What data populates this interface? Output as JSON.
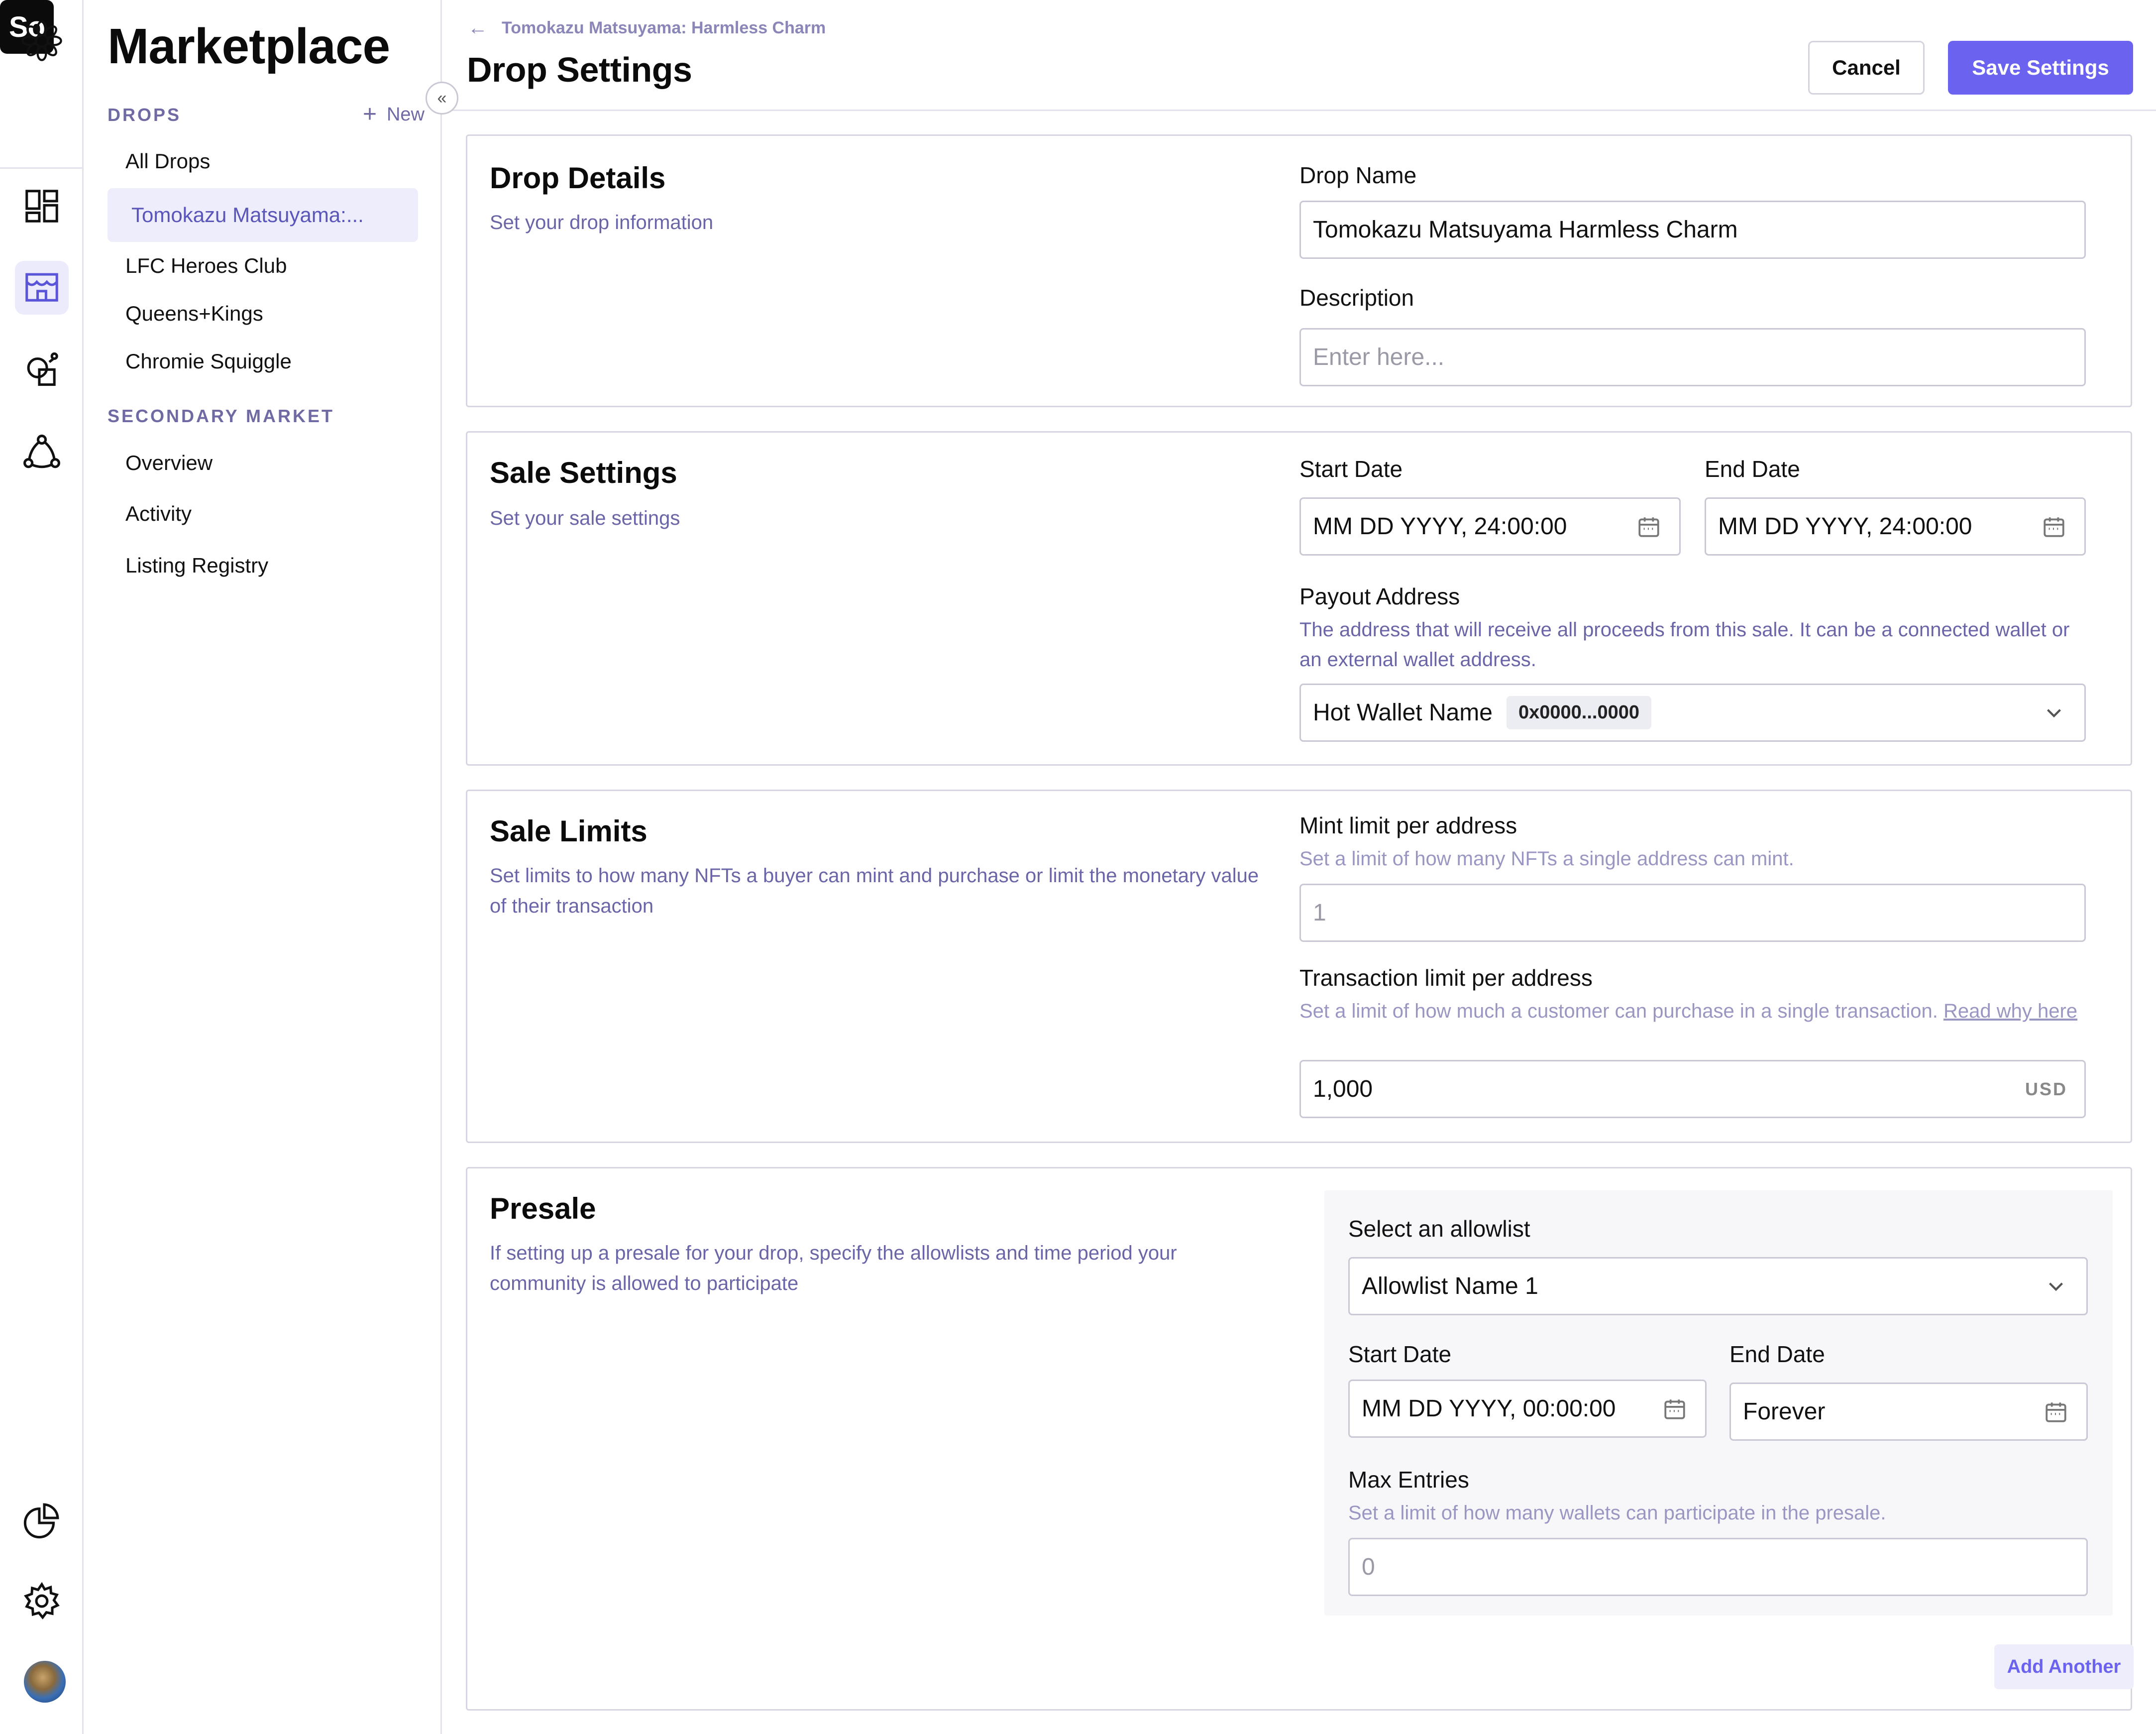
{
  "rail": {
    "org_initials": "So",
    "icons": [
      "logo-flower-icon",
      "dashboard-icon",
      "marketplace-icon",
      "assets-icon",
      "network-icon",
      "analytics-icon",
      "settings-icon"
    ]
  },
  "sidebar": {
    "title": "Marketplace",
    "drops_label": "DROPS",
    "new_label": "New",
    "drops": [
      "All Drops",
      "Tomokazu Matsuyama:...",
      "LFC Heroes Club",
      "Queens+Kings",
      "Chromie Squiggle"
    ],
    "secondary_label": "SECONDARY MARKET",
    "secondary": [
      "Overview",
      "Activity",
      "Listing Registry"
    ]
  },
  "header": {
    "breadcrumb": "Tomokazu Matsuyama: Harmless Charm",
    "title": "Drop Settings",
    "cancel": "Cancel",
    "save": "Save Settings"
  },
  "drop_details": {
    "title": "Drop Details",
    "desc": "Set your drop information",
    "name_label": "Drop Name",
    "name_value": "Tomokazu Matsuyama Harmless Charm",
    "description_label": "Description",
    "description_placeholder": "Enter here..."
  },
  "sale_settings": {
    "title": "Sale Settings",
    "desc": "Set your sale settings",
    "start_label": "Start Date",
    "start_value": "MM DD YYYY, 24:00:00",
    "end_label": "End Date",
    "end_value": "MM DD YYYY, 24:00:00",
    "payout_label": "Payout Address",
    "payout_help": "The address that will receive all proceeds from this sale. It can be a connected wallet or an external wallet address.",
    "wallet_name": "Hot Wallet Name",
    "wallet_address": "0x0000...0000"
  },
  "sale_limits": {
    "title": "Sale Limits",
    "desc": "Set limits to how many NFTs a buyer can mint and purchase or limit the monetary value of their transaction",
    "mint_label": "Mint limit per address",
    "mint_help": "Set a limit of how many NFTs a single address can mint.",
    "mint_placeholder": "1",
    "tx_label": "Transaction limit per address",
    "tx_help": "Set a limit of how much a customer can purchase in a single transaction.",
    "tx_help_link": "Read why here",
    "tx_value": "1,000",
    "tx_currency": "USD"
  },
  "presale": {
    "title": "Presale",
    "desc": "If setting up a presale for your drop, specify the allowlists and time period your community is allowed to participate",
    "allowlist_label": "Select an allowlist",
    "allowlist_value": "Allowlist Name 1",
    "start_label": "Start Date",
    "start_value": "MM DD YYYY, 00:00:00",
    "end_label": "End Date",
    "end_value": "Forever",
    "max_label": "Max Entries",
    "max_help": "Set a limit of how many wallets can participate in the presale.",
    "max_placeholder": "0",
    "add_another": "Add Another"
  },
  "colors": {
    "accent": "#6b63f0",
    "muted_text": "#6a65a6",
    "active_nav_bg": "#eeedfb"
  }
}
